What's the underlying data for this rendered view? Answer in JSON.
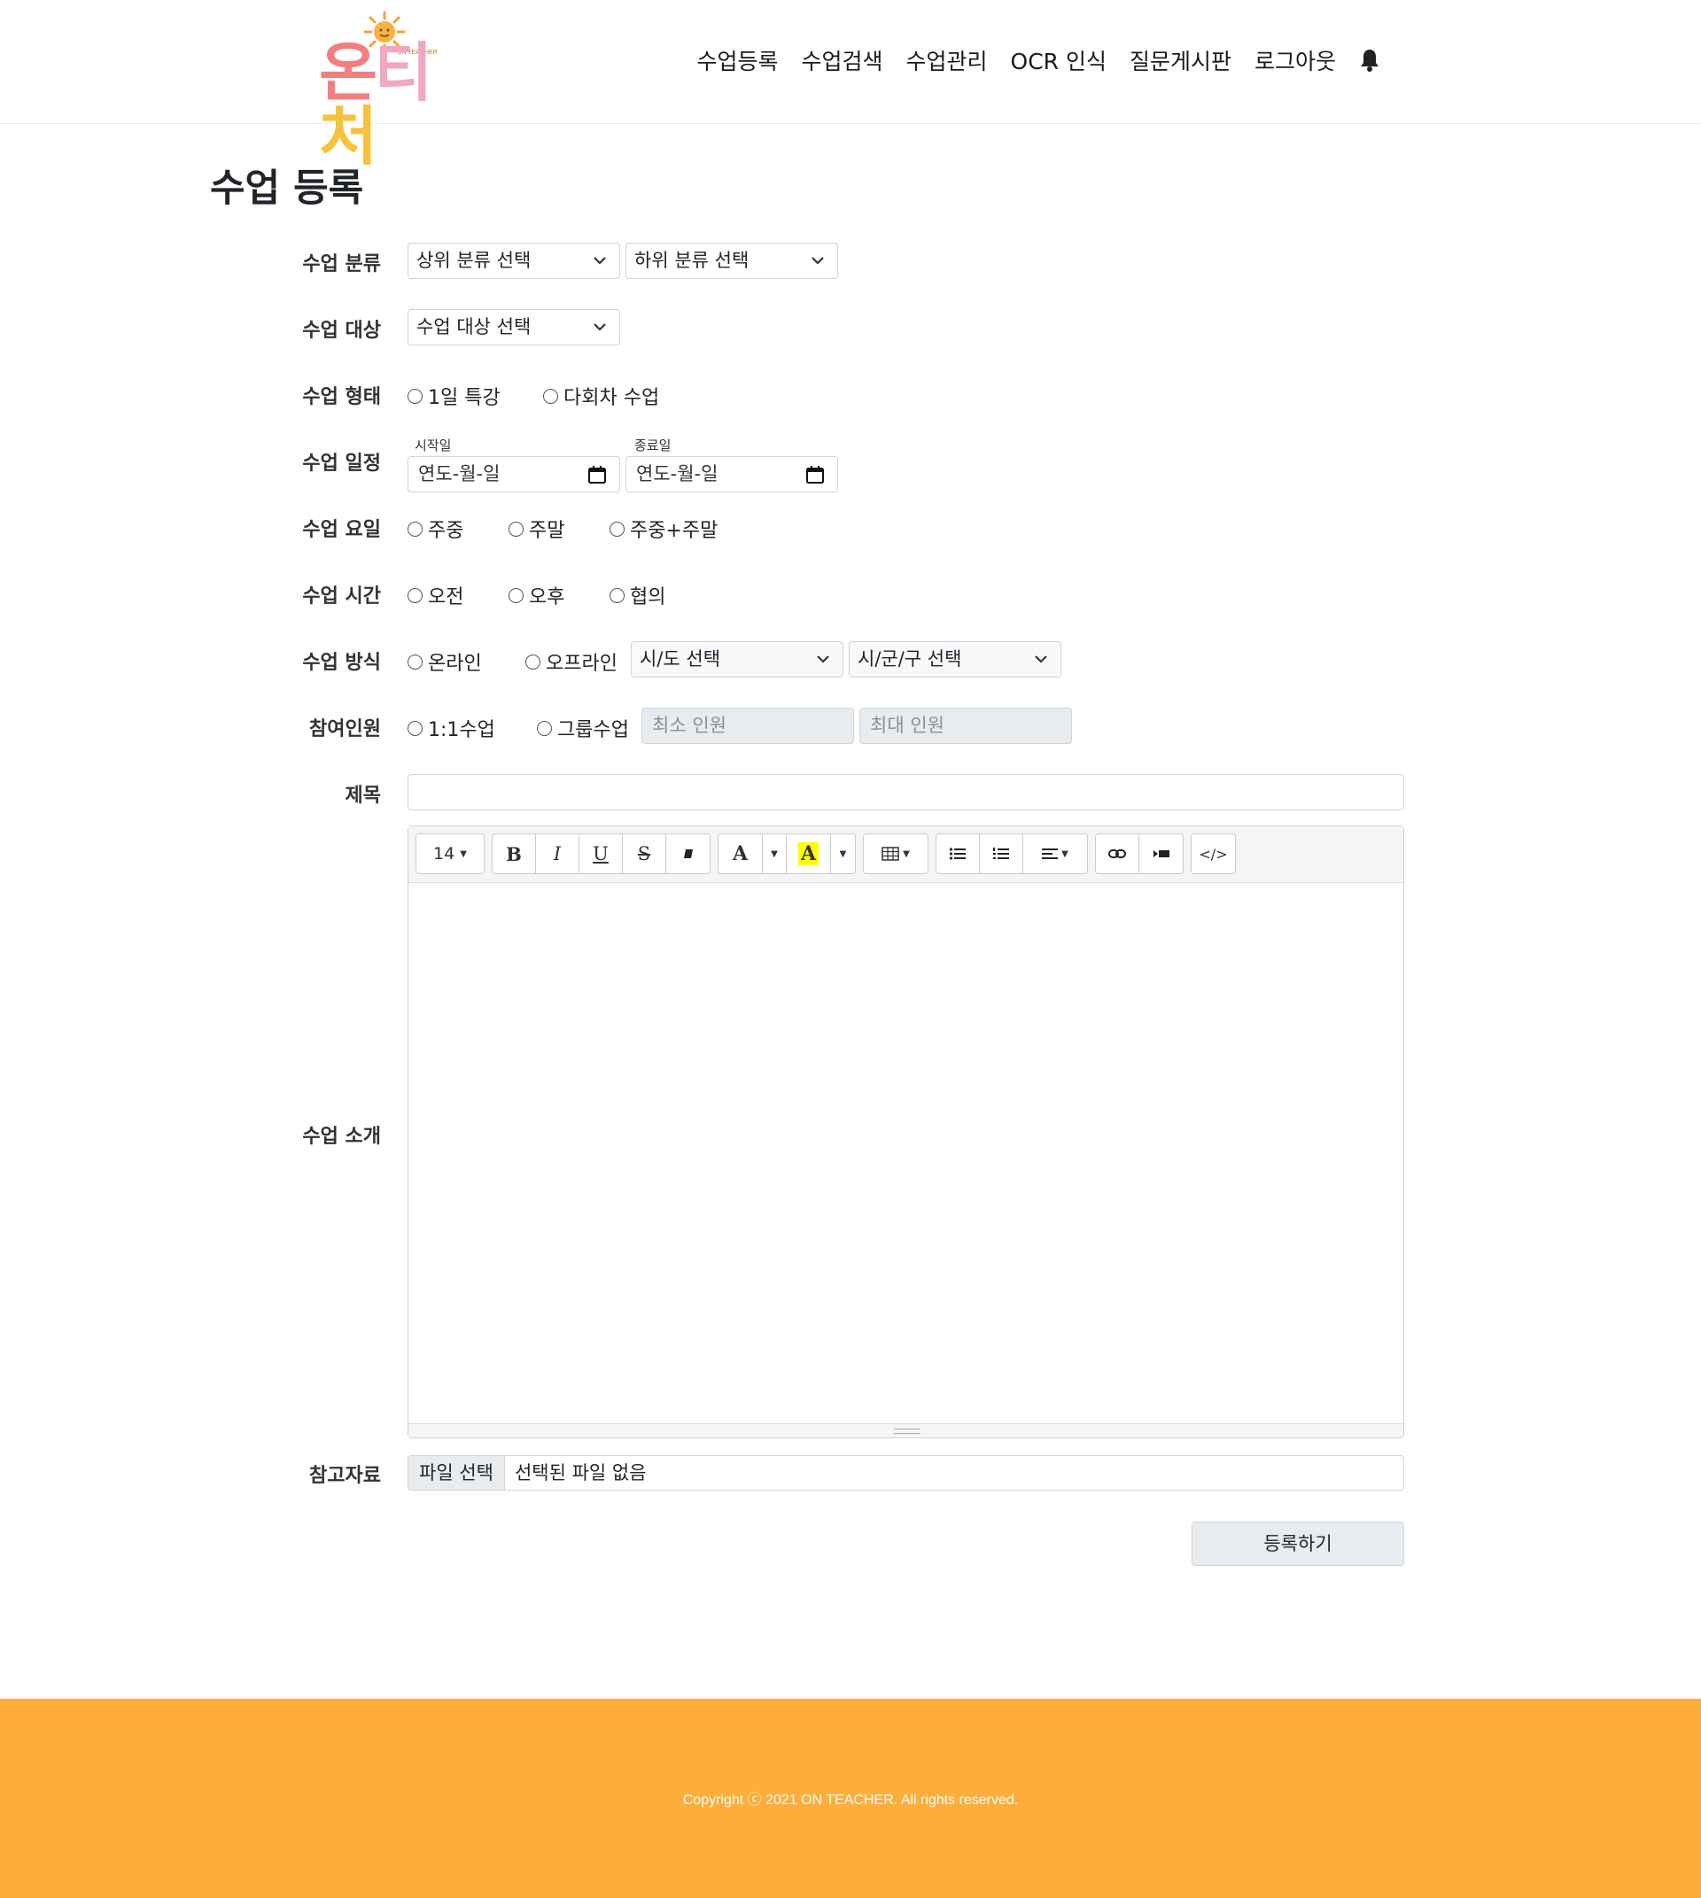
{
  "brand": {
    "logo_text": [
      "온",
      "티",
      "처"
    ],
    "logo_small": "ON TEACHER",
    "colors": {
      "pink": "#f27f7f",
      "light_pink": "#f0a7c4",
      "yellow": "#f6c23c",
      "footer": "#fdad3a"
    }
  },
  "nav": {
    "items": [
      "수업등록",
      "수업검색",
      "수업관리",
      "OCR 인식",
      "질문게시판",
      "로그아웃"
    ],
    "bell_icon": "bell-icon"
  },
  "page": {
    "title": "수업 등록"
  },
  "form": {
    "category": {
      "label": "수업 분류",
      "top_select": "상위 분류 선택",
      "sub_select": "하위 분류 선택"
    },
    "target": {
      "label": "수업 대상",
      "select": "수업 대상 선택"
    },
    "type": {
      "label": "수업 형태",
      "options": [
        "1일 특강",
        "다회차 수업"
      ]
    },
    "schedule": {
      "label": "수업 일정",
      "start_label": "시작일",
      "end_label": "종료일",
      "start_placeholder": "연도-월-일",
      "end_placeholder": "연도-월-일"
    },
    "days": {
      "label": "수업 요일",
      "options": [
        "주중",
        "주말",
        "주중+주말"
      ]
    },
    "time": {
      "label": "수업 시간",
      "options": [
        "오전",
        "오후",
        "협의"
      ]
    },
    "method": {
      "label": "수업 방식",
      "options": [
        "온라인",
        "오프라인"
      ],
      "city_select": "시/도 선택",
      "district_select": "시/군/구 선택"
    },
    "participants": {
      "label": "참여인원",
      "options": [
        "1:1수업",
        "그룹수업"
      ],
      "min_placeholder": "최소 인원",
      "max_placeholder": "최대 인원"
    },
    "title": {
      "label": "제목",
      "value": ""
    },
    "intro": {
      "label": "수업 소개",
      "toolbar": {
        "font_size": "14",
        "bold": "B",
        "italic": "I",
        "underline": "U",
        "strike": "S",
        "font_color": "A",
        "highlight": "A",
        "highlight_color": "#ffff00",
        "code": "</>"
      }
    },
    "file": {
      "label": "참고자료",
      "button": "파일 선택",
      "status": "선택된 파일 없음"
    },
    "submit": "등록하기"
  },
  "footer": {
    "copyright": "Copyright ⓒ 2021 ON TEACHER. All rights reserved."
  }
}
